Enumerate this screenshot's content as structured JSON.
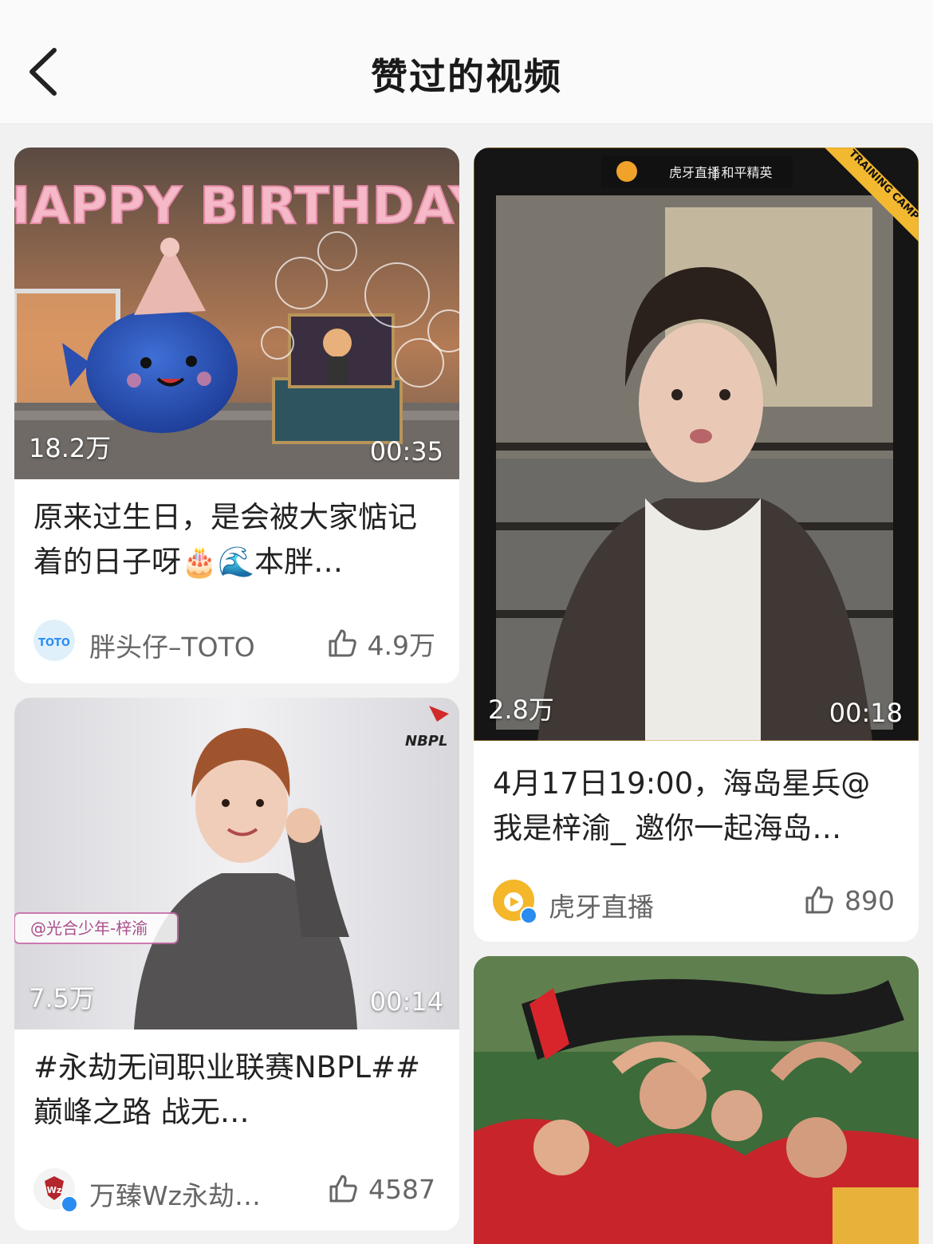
{
  "nav": {
    "title": "赞过的视频"
  },
  "videos": [
    {
      "play_count": "18.2万",
      "duration": "00:35",
      "title": "原来过生日，是会被大家惦记着的日子呀🎂🌊本胖…",
      "author": "胖头仔–TOTO",
      "likes": "4.9万",
      "thumb_text": "HAPPY BIRTHDAY",
      "avatar_text": "TOTO"
    },
    {
      "play_count": "2.8万",
      "duration": "00:18",
      "title": "4月17日19:00，海岛星兵@我是梓渝_ 邀你一起海岛…",
      "author": "虎牙直播",
      "likes": "890",
      "thumb_text": "TRAINING CAMP"
    },
    {
      "play_count": "7.5万",
      "duration": "00:14",
      "title": "#永劫无间职业联赛NBPL##巅峰之路 战无…",
      "author": "万臻Wz永劫…",
      "likes": "4587",
      "thumb_text": "@光合少年-梓渝",
      "logo_text": "NBPL"
    },
    {
      "thumb_text": ""
    }
  ],
  "colors": {
    "accent": "#2a8cf0",
    "background": "#f1f1f1"
  }
}
